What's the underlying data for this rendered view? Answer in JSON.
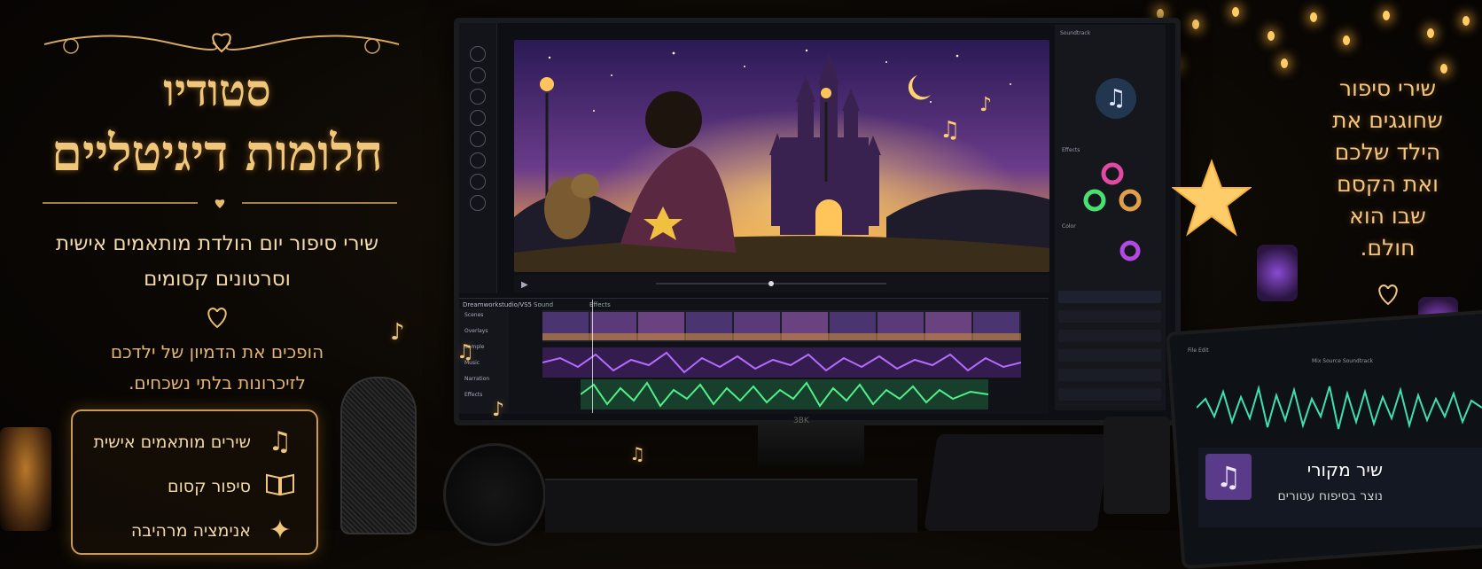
{
  "brand": {
    "title_line1": "סטודיו",
    "title_line2": "חלומות דיגיטליים"
  },
  "intro": {
    "subtitle_line1": "שירי סיפור יום הולדת מותאמים אישית",
    "subtitle_line2": "וסרטונים קסומים",
    "desc_line1": "הופכים את הדמיון של ילדכם",
    "desc_line2": "לזיכרונות בלתי נשכחים."
  },
  "features": [
    {
      "label": "שירים מותאמים אישית",
      "icon": "music-note-icon",
      "glyph": "♫"
    },
    {
      "label": "סיפור קסום",
      "icon": "open-book-icon",
      "glyph": "📖"
    },
    {
      "label": "אנימציה מרהיבה",
      "icon": "sparkle-icon",
      "glyph": "✦"
    }
  ],
  "tagline": {
    "lines": [
      "שירי סיפור",
      "שחוגגים את",
      "הילד שלכם",
      "ואת הקסם",
      "שבו הוא",
      "חולם."
    ]
  },
  "editor": {
    "monitor_brand": "3BK",
    "project_name": "Dreamworkstudio/VS5",
    "tab_sound": "Sound",
    "tab_effect": "Effects",
    "track_names": [
      "Scenes",
      "Overlays",
      "Sample",
      "Music",
      "Narration",
      "Effects"
    ],
    "panel_music_label": "Soundtrack",
    "panel_effects_label": "Effects",
    "panel_color_label": "Color"
  },
  "player": {
    "song_title": "שיר מקורי",
    "song_subtitle": "נוצר בסיפוח עטורים",
    "menu_left": "File  Edit",
    "menu_right": "Mix  Source  Soundtrack"
  },
  "colors": {
    "accent_gold": "#f0c77a",
    "purple_wave": "#9b4fe0",
    "green_wave": "#3ddc6a",
    "teal_wave": "#3fe0b0"
  }
}
